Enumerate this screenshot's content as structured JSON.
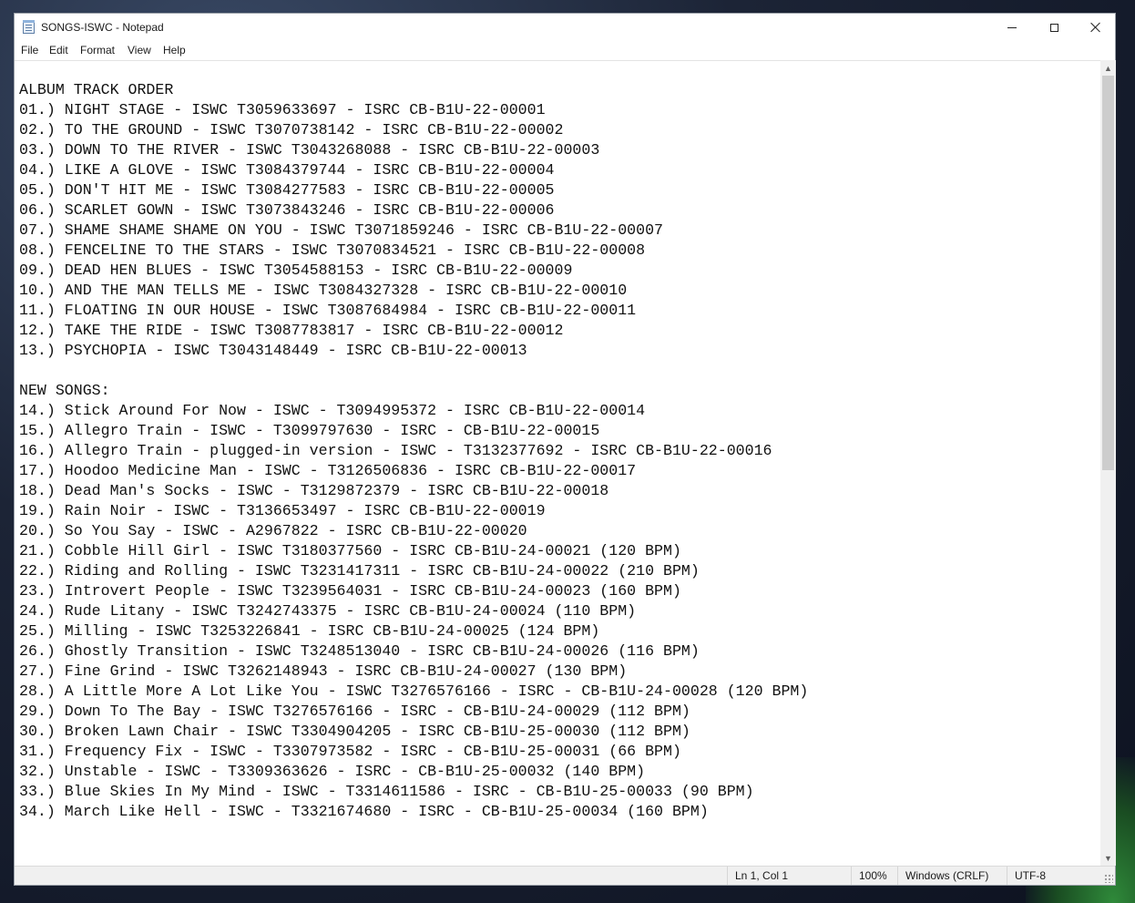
{
  "window": {
    "title": "SONGS-ISWC - Notepad"
  },
  "menu": {
    "file": "File",
    "edit": "Edit",
    "format": "Format",
    "view": "View",
    "help": "Help"
  },
  "document": {
    "lines": [
      "ALBUM TRACK ORDER",
      "01.) NIGHT STAGE - ISWC T3059633697 - ISRC CB-B1U-22-00001",
      "02.) TO THE GROUND - ISWC T3070738142 - ISRC CB-B1U-22-00002",
      "03.) DOWN TO THE RIVER - ISWC T3043268088 - ISRC CB-B1U-22-00003",
      "04.) LIKE A GLOVE - ISWC T3084379744 - ISRC CB-B1U-22-00004",
      "05.) DON'T HIT ME - ISWC T3084277583 - ISRC CB-B1U-22-00005",
      "06.) SCARLET GOWN - ISWC T3073843246 - ISRC CB-B1U-22-00006",
      "07.) SHAME SHAME SHAME ON YOU - ISWC T3071859246 - ISRC CB-B1U-22-00007",
      "08.) FENCELINE TO THE STARS - ISWC T3070834521 - ISRC CB-B1U-22-00008",
      "09.) DEAD HEN BLUES - ISWC T3054588153 - ISRC CB-B1U-22-00009",
      "10.) AND THE MAN TELLS ME - ISWC T3084327328 - ISRC CB-B1U-22-00010",
      "11.) FLOATING IN OUR HOUSE - ISWC T3087684984 - ISRC CB-B1U-22-00011",
      "12.) TAKE THE RIDE - ISWC T3087783817 - ISRC CB-B1U-22-00012",
      "13.) PSYCHOPIA - ISWC T3043148449 - ISRC CB-B1U-22-00013",
      "",
      "NEW SONGS:",
      "14.) Stick Around For Now - ISWC - T3094995372 - ISRC CB-B1U-22-00014",
      "15.) Allegro Train - ISWC - T3099797630 - ISRC - CB-B1U-22-00015",
      "16.) Allegro Train - plugged-in version - ISWC - T3132377692 - ISRC CB-B1U-22-00016",
      "17.) Hoodoo Medicine Man - ISWC - T3126506836 - ISRC CB-B1U-22-00017",
      "18.) Dead Man's Socks - ISWC - T3129872379 - ISRC CB-B1U-22-00018",
      "19.) Rain Noir - ISWC - T3136653497 - ISRC CB-B1U-22-00019",
      "20.) So You Say - ISWC - A2967822 - ISRC CB-B1U-22-00020",
      "21.) Cobble Hill Girl - ISWC T3180377560 - ISRC CB-B1U-24-00021 (120 BPM)",
      "22.) Riding and Rolling - ISWC T3231417311 - ISRC CB-B1U-24-00022 (210 BPM)",
      "23.) Introvert People - ISWC T3239564031 - ISRC CB-B1U-24-00023 (160 BPM)",
      "24.) Rude Litany - ISWC T3242743375 - ISRC CB-B1U-24-00024 (110 BPM)",
      "25.) Milling - ISWC T3253226841 - ISRC CB-B1U-24-00025 (124 BPM)",
      "26.) Ghostly Transition - ISWC T3248513040 - ISRC CB-B1U-24-00026 (116 BPM)",
      "27.) Fine Grind - ISWC T3262148943 - ISRC CB-B1U-24-00027 (130 BPM)",
      "28.) A Little More A Lot Like You - ISWC T3276576166 - ISRC - CB-B1U-24-00028 (120 BPM)",
      "29.) Down To The Bay - ISWC T3276576166 - ISRC - CB-B1U-24-00029 (112 BPM)",
      "30.) Broken Lawn Chair - ISWC T3304904205 - ISRC CB-B1U-25-00030 (112 BPM)",
      "31.) Frequency Fix - ISWC - T3307973582 - ISRC - CB-B1U-25-00031 (66 BPM)",
      "32.) Unstable - ISWC - T3309363626 - ISRC - CB-B1U-25-00032 (140 BPM)",
      "33.) Blue Skies In My Mind - ISWC - T3314611586 - ISRC - CB-B1U-25-00033 (90 BPM)",
      "34.) March Like Hell - ISWC - T3321674680 - ISRC - CB-B1U-25-00034 (160 BPM)"
    ]
  },
  "status": {
    "position": "Ln 1, Col 1",
    "zoom": "100%",
    "line_endings": "Windows (CRLF)",
    "encoding": "UTF-8"
  },
  "icons": {
    "app": "notepad-icon",
    "minimize": "minimize-icon",
    "maximize": "maximize-icon",
    "close": "close-icon"
  }
}
